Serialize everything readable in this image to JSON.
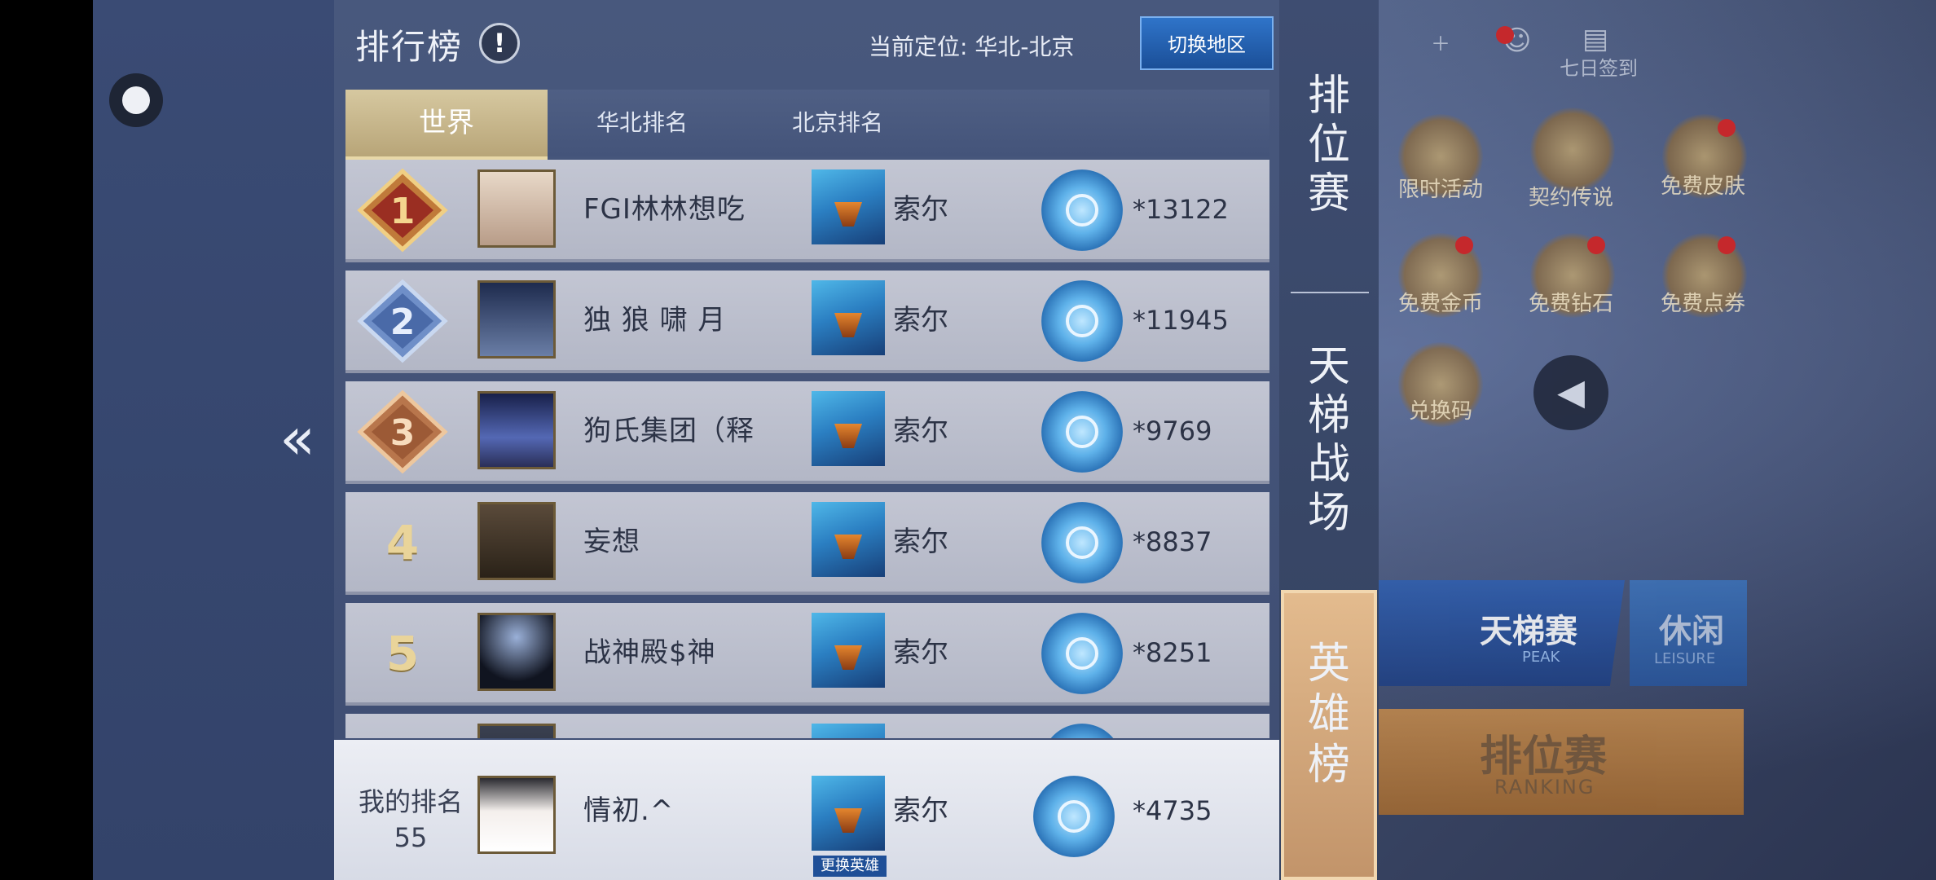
{
  "header": {
    "title": "排行榜",
    "location_label": "当前定位: 华北-北京",
    "switch_region": "切换地区"
  },
  "tabs": [
    {
      "label": "世界",
      "active": true
    },
    {
      "label": "华北排名",
      "active": false
    },
    {
      "label": "北京排名",
      "active": false
    }
  ],
  "rows": [
    {
      "rank": "1",
      "name": "FGI林林想吃",
      "hero": "索尔",
      "score": "*13122",
      "rank_style": "gold"
    },
    {
      "rank": "2",
      "name": "独 狼 啸 月",
      "hero": "索尔",
      "score": "*11945",
      "rank_style": "silver"
    },
    {
      "rank": "3",
      "name": "狗氏集团（释",
      "hero": "索尔",
      "score": "*9769",
      "rank_style": "bronze"
    },
    {
      "rank": "4",
      "name": "妄想",
      "hero": "索尔",
      "score": "*8837",
      "rank_style": "plain"
    },
    {
      "rank": "5",
      "name": "战神殿$神",
      "hero": "索尔",
      "score": "*8251",
      "rank_style": "plain"
    }
  ],
  "my_rank": {
    "label": "我的排名",
    "rank": "55",
    "name": "情初.^",
    "hero": "索尔",
    "score": "*4735",
    "change_hero": "更换英雄"
  },
  "side_tabs": [
    {
      "label": "排位赛",
      "active": false
    },
    {
      "label": "天梯战场",
      "active": false
    },
    {
      "label": "英雄榜",
      "active": true
    }
  ],
  "game_menu": {
    "daily_signin": "七日签到",
    "items": [
      {
        "label": "限时活动"
      },
      {
        "label": "契约传说"
      },
      {
        "label": "免费皮肤"
      },
      {
        "label": "免费金币"
      },
      {
        "label": "免费钻石"
      },
      {
        "label": "免费点券"
      },
      {
        "label": "兑换码"
      }
    ],
    "peak_button": {
      "title": "天梯赛",
      "subtitle": "PEAK"
    },
    "leisure_button": {
      "title": "休闲",
      "subtitle": "LEISURE"
    },
    "ranking_button": {
      "title": "排位赛",
      "subtitle": "RANKING"
    }
  },
  "colors": {
    "active_tab": "#c2946a",
    "switch_button": "#1b4f98",
    "row_bg": "#bfc3d0"
  }
}
